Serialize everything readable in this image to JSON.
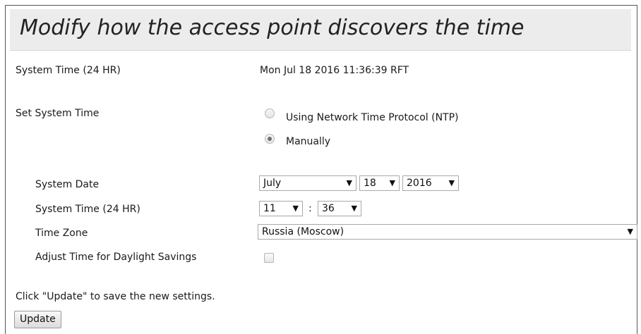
{
  "header": {
    "title": "Modify how the access point discovers the time"
  },
  "system_time_row": {
    "label": "System Time (24 HR)",
    "value": "Mon Jul 18 2016 11:36:39 RFT"
  },
  "set_system_time": {
    "label": "Set System Time",
    "options": [
      {
        "label": "Using Network Time Protocol (NTP)",
        "checked": false
      },
      {
        "label": "Manually",
        "checked": true
      }
    ]
  },
  "manual": {
    "date_label": "System Date",
    "month": "July",
    "day": "18",
    "year": "2016",
    "time_label": "System Time (24 HR)",
    "hour": "11",
    "time_separator": ":",
    "minute": "36",
    "timezone_label": "Time Zone",
    "timezone": "Russia (Moscow)",
    "dst_label": "Adjust Time for Daylight Savings",
    "dst_checked": false
  },
  "footer": {
    "hint": "Click \"Update\" to save the new settings.",
    "update_label": "Update"
  },
  "icons": {
    "dropdown": "chevron-down-icon"
  },
  "colors": {
    "header_bg": "#ececec",
    "border": "#555555"
  }
}
